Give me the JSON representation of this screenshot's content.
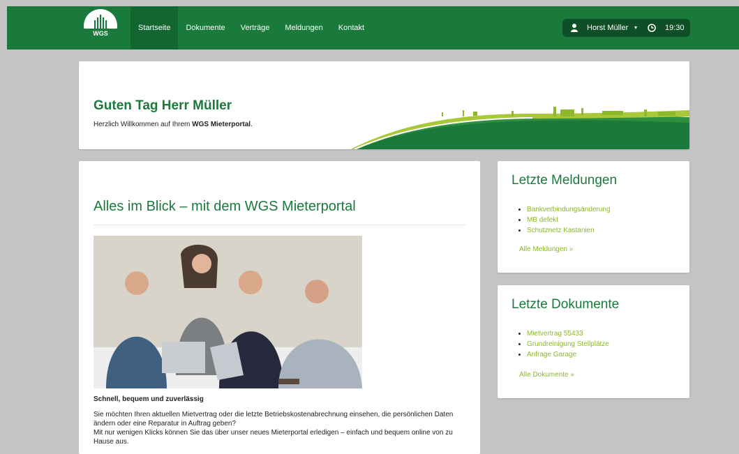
{
  "header": {
    "logo_text": "WGS",
    "nav": [
      "Startseite",
      "Dokumente",
      "Verträge",
      "Meldungen",
      "Kontakt"
    ],
    "active_nav": "Startseite",
    "user_name": "Horst Müller",
    "caret": "▾",
    "time": "19:30",
    "colors": {
      "brand": "#1a7a3c",
      "accent": "#8cb82a"
    }
  },
  "hero": {
    "title": "Guten Tag Herr Müller",
    "subtitle_prefix": "Herzlich Willkommen auf Ihrem ",
    "subtitle_bold": "WGS Mieterportal",
    "subtitle_suffix": "."
  },
  "main": {
    "title": "Alles im Blick – mit dem WGS Mieterportal",
    "subtitle": "Schnell, bequem und zuverlässig",
    "paragraph": [
      "Sie möchten Ihren aktuellen Mietvertrag oder die letzte Betriebskostenabrechnung einsehen, die persönlichen Daten ändern oder eine Reparatur in Auftrag geben?",
      "Mit nur wenigen Klicks können Sie das über unser neues Mieterportal erledigen – einfach und bequem online von zu Hause aus."
    ]
  },
  "meldungen": {
    "title": "Letzte Meldungen",
    "items": [
      "Bankverbindungsänderung",
      "MB defekt",
      "Schutznetz Kastanien"
    ],
    "more": "Alle Meldungen »"
  },
  "dokumente": {
    "title": "Letzte Dokumente",
    "items": [
      "Mietvertrag 55433",
      "Grundreinigung Stellplätze",
      "Anfrage Garage"
    ],
    "more": "Alle Dokumente »"
  }
}
